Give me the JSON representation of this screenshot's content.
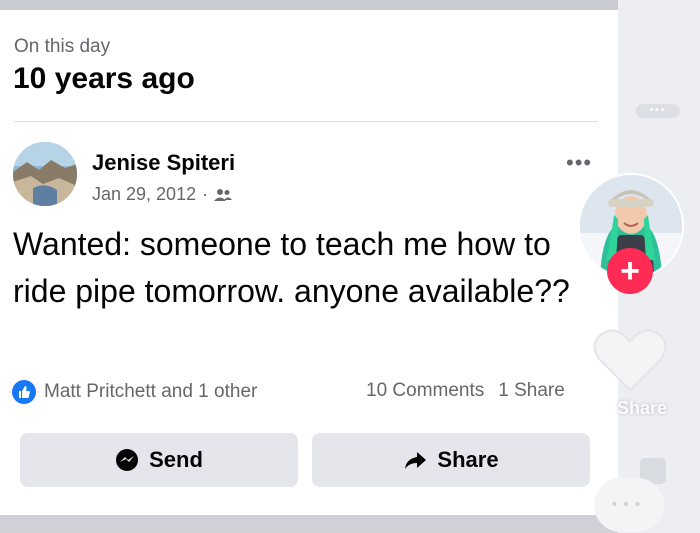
{
  "memory": {
    "label": "On this day",
    "title": "10 years ago"
  },
  "post": {
    "author": "Jenise Spiteri",
    "date": "Jan 29, 2012",
    "separator": "·",
    "audience_icon": "friends-icon",
    "more_label": "•••",
    "text": "Wanted: someone to teach me how to ride pipe tomorrow. anyone available??"
  },
  "engagement": {
    "reactions_text": "Matt Pritchett and 1 other",
    "comments": "10 Comments",
    "shares": "1 Share"
  },
  "actions": {
    "send_label": "Send",
    "share_label": "Share"
  },
  "overlay": {
    "follow_label": "+",
    "share_label": "Share",
    "more_label": "•••",
    "gutter_more_label": "•••",
    "accent_color": "#fe2c55"
  },
  "colors": {
    "facebook_blue": "#1877f2",
    "button_gray": "#e4e6eb"
  }
}
